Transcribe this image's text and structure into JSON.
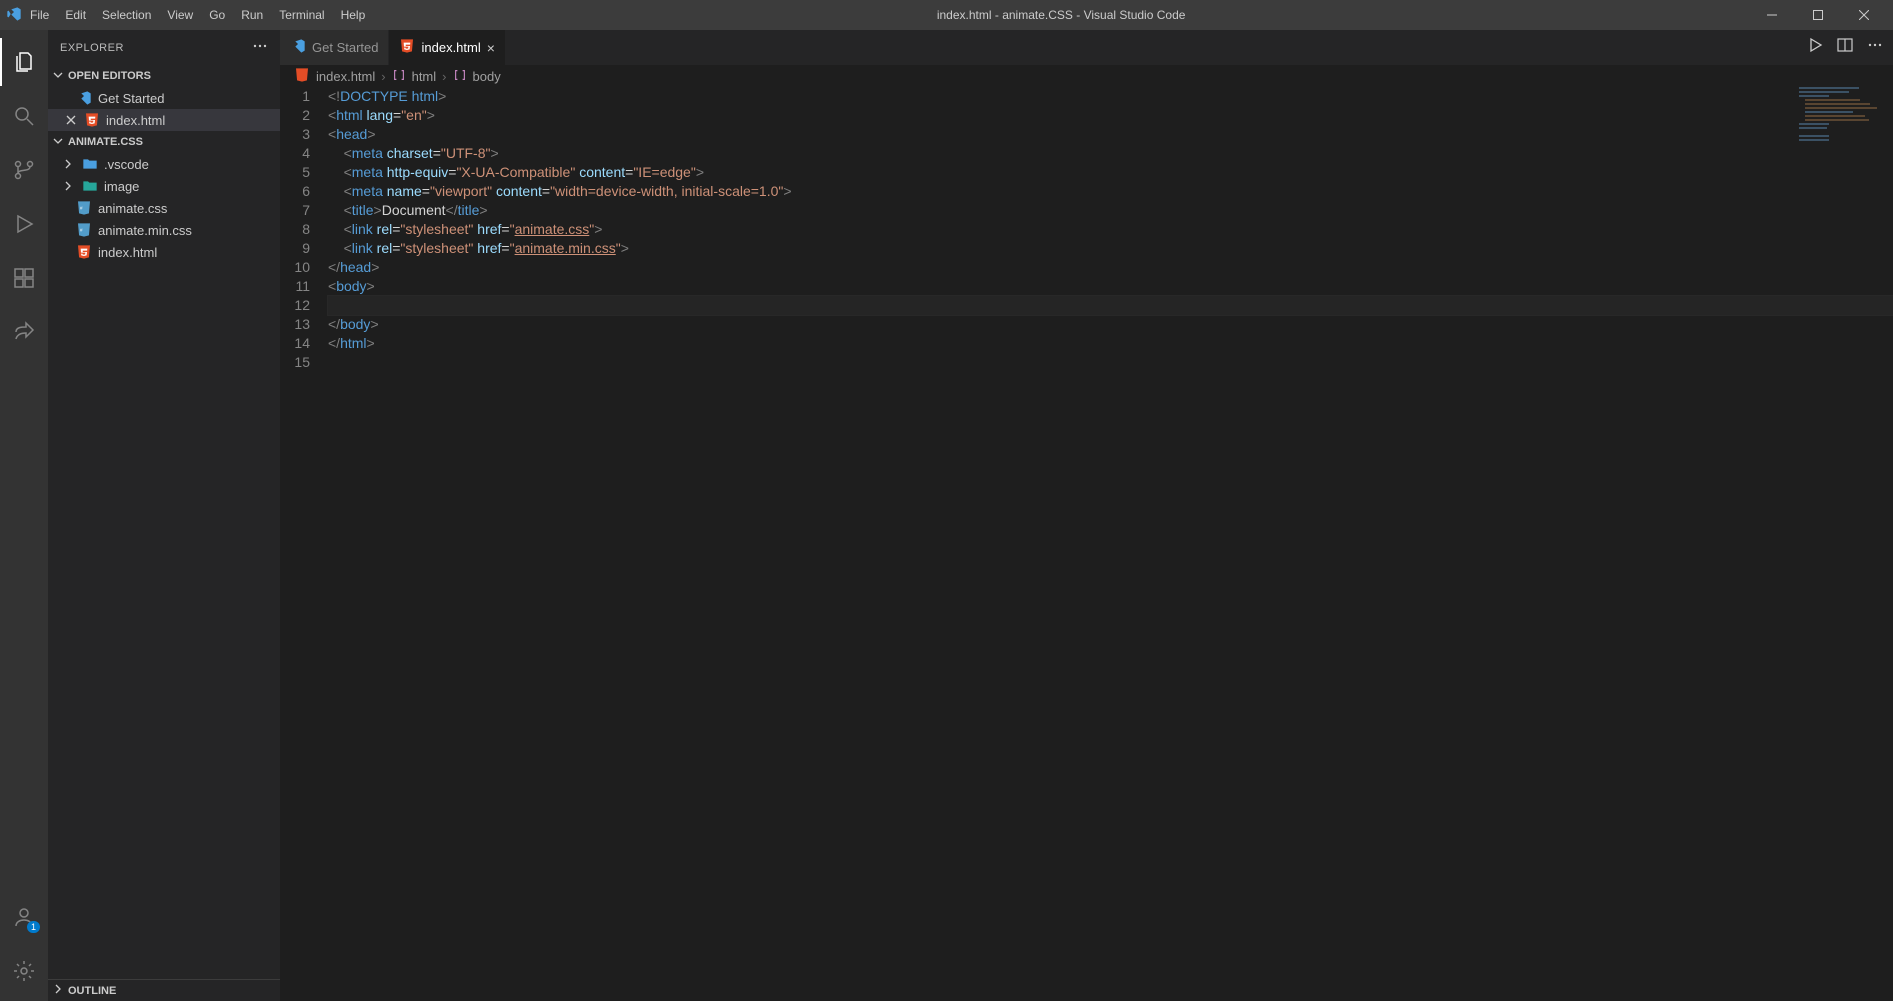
{
  "title_bar": {
    "window_title": "index.html - animate.CSS - Visual Studio Code",
    "menu": [
      "File",
      "Edit",
      "Selection",
      "View",
      "Go",
      "Run",
      "Terminal",
      "Help"
    ]
  },
  "activity_bar": {
    "account_badge": "1"
  },
  "sidebar": {
    "title": "EXPLORER",
    "open_editors_label": "OPEN EDITORS",
    "open_editors": [
      {
        "label": "Get Started",
        "icon": "vscode",
        "closable": false
      },
      {
        "label": "index.html",
        "icon": "html",
        "closable": true
      }
    ],
    "project_label": "ANIMATE.CSS",
    "tree": [
      {
        "label": ".vscode",
        "type": "folder",
        "icon": "folder-blue",
        "expandable": true
      },
      {
        "label": "image",
        "type": "folder",
        "icon": "folder-teal",
        "expandable": true
      },
      {
        "label": "animate.css",
        "type": "file",
        "icon": "css"
      },
      {
        "label": "animate.min.css",
        "type": "file",
        "icon": "css"
      },
      {
        "label": "index.html",
        "type": "file",
        "icon": "html"
      }
    ],
    "outline_label": "OUTLINE"
  },
  "tabs": [
    {
      "label": "Get Started",
      "icon": "vscode",
      "active": false
    },
    {
      "label": "index.html",
      "icon": "html",
      "active": true,
      "close": "×"
    }
  ],
  "breadcrumbs": [
    {
      "label": "index.html",
      "icon": "html"
    },
    {
      "label": "html",
      "icon": "brackets"
    },
    {
      "label": "body",
      "icon": "brackets"
    }
  ],
  "code": {
    "line_numbers": [
      "1",
      "2",
      "3",
      "4",
      "5",
      "6",
      "7",
      "8",
      "9",
      "10",
      "11",
      "12",
      "13",
      "14",
      "15"
    ],
    "current_line_index": 11,
    "lines": [
      [
        {
          "t": "<!",
          "c": "gray"
        },
        {
          "t": "DOCTYPE ",
          "c": "blue"
        },
        {
          "t": "html",
          "c": "blue"
        },
        {
          "t": ">",
          "c": "gray"
        }
      ],
      [
        {
          "t": "<",
          "c": "gray"
        },
        {
          "t": "html ",
          "c": "blue"
        },
        {
          "t": "lang",
          "c": "lightblue"
        },
        {
          "t": "=",
          "c": "white"
        },
        {
          "t": "\"en\"",
          "c": "orange"
        },
        {
          "t": ">",
          "c": "gray"
        }
      ],
      [
        {
          "t": "<",
          "c": "gray"
        },
        {
          "t": "head",
          "c": "blue"
        },
        {
          "t": ">",
          "c": "gray"
        }
      ],
      [
        {
          "t": "    ",
          "c": "white"
        },
        {
          "t": "<",
          "c": "gray"
        },
        {
          "t": "meta ",
          "c": "blue"
        },
        {
          "t": "charset",
          "c": "lightblue"
        },
        {
          "t": "=",
          "c": "white"
        },
        {
          "t": "\"UTF-8\"",
          "c": "orange"
        },
        {
          "t": ">",
          "c": "gray"
        }
      ],
      [
        {
          "t": "    ",
          "c": "white"
        },
        {
          "t": "<",
          "c": "gray"
        },
        {
          "t": "meta ",
          "c": "blue"
        },
        {
          "t": "http-equiv",
          "c": "lightblue"
        },
        {
          "t": "=",
          "c": "white"
        },
        {
          "t": "\"X-UA-Compatible\"",
          "c": "orange"
        },
        {
          "t": " ",
          "c": "white"
        },
        {
          "t": "content",
          "c": "lightblue"
        },
        {
          "t": "=",
          "c": "white"
        },
        {
          "t": "\"IE=edge\"",
          "c": "orange"
        },
        {
          "t": ">",
          "c": "gray"
        }
      ],
      [
        {
          "t": "    ",
          "c": "white"
        },
        {
          "t": "<",
          "c": "gray"
        },
        {
          "t": "meta ",
          "c": "blue"
        },
        {
          "t": "name",
          "c": "lightblue"
        },
        {
          "t": "=",
          "c": "white"
        },
        {
          "t": "\"viewport\"",
          "c": "orange"
        },
        {
          "t": " ",
          "c": "white"
        },
        {
          "t": "content",
          "c": "lightblue"
        },
        {
          "t": "=",
          "c": "white"
        },
        {
          "t": "\"width=device-width, initial-scale=1.0\"",
          "c": "orange"
        },
        {
          "t": ">",
          "c": "gray"
        }
      ],
      [
        {
          "t": "    ",
          "c": "white"
        },
        {
          "t": "<",
          "c": "gray"
        },
        {
          "t": "title",
          "c": "blue"
        },
        {
          "t": ">",
          "c": "gray"
        },
        {
          "t": "Document",
          "c": "white"
        },
        {
          "t": "</",
          "c": "gray"
        },
        {
          "t": "title",
          "c": "blue"
        },
        {
          "t": ">",
          "c": "gray"
        }
      ],
      [
        {
          "t": "    ",
          "c": "white"
        },
        {
          "t": "<",
          "c": "gray"
        },
        {
          "t": "link ",
          "c": "blue"
        },
        {
          "t": "rel",
          "c": "lightblue"
        },
        {
          "t": "=",
          "c": "white"
        },
        {
          "t": "\"stylesheet\"",
          "c": "orange"
        },
        {
          "t": " ",
          "c": "white"
        },
        {
          "t": "href",
          "c": "lightblue"
        },
        {
          "t": "=",
          "c": "white"
        },
        {
          "t": "\"",
          "c": "orange"
        },
        {
          "t": "animate.css",
          "c": "orange underline"
        },
        {
          "t": "\"",
          "c": "orange"
        },
        {
          "t": ">",
          "c": "gray"
        }
      ],
      [
        {
          "t": "    ",
          "c": "white"
        },
        {
          "t": "<",
          "c": "gray"
        },
        {
          "t": "link ",
          "c": "blue"
        },
        {
          "t": "rel",
          "c": "lightblue"
        },
        {
          "t": "=",
          "c": "white"
        },
        {
          "t": "\"stylesheet\"",
          "c": "orange"
        },
        {
          "t": " ",
          "c": "white"
        },
        {
          "t": "href",
          "c": "lightblue"
        },
        {
          "t": "=",
          "c": "white"
        },
        {
          "t": "\"",
          "c": "orange"
        },
        {
          "t": "animate.min.css",
          "c": "orange underline"
        },
        {
          "t": "\"",
          "c": "orange"
        },
        {
          "t": ">",
          "c": "gray"
        }
      ],
      [
        {
          "t": "</",
          "c": "gray"
        },
        {
          "t": "head",
          "c": "blue"
        },
        {
          "t": ">",
          "c": "gray"
        }
      ],
      [
        {
          "t": "<",
          "c": "gray"
        },
        {
          "t": "body",
          "c": "blue"
        },
        {
          "t": ">",
          "c": "gray"
        }
      ],
      [
        {
          "t": "    ",
          "c": "white"
        }
      ],
      [
        {
          "t": "</",
          "c": "gray"
        },
        {
          "t": "body",
          "c": "blue"
        },
        {
          "t": ">",
          "c": "gray"
        }
      ],
      [
        {
          "t": "</",
          "c": "gray"
        },
        {
          "t": "html",
          "c": "blue"
        },
        {
          "t": ">",
          "c": "gray"
        }
      ],
      [
        {
          "t": "",
          "c": "white"
        }
      ]
    ]
  }
}
